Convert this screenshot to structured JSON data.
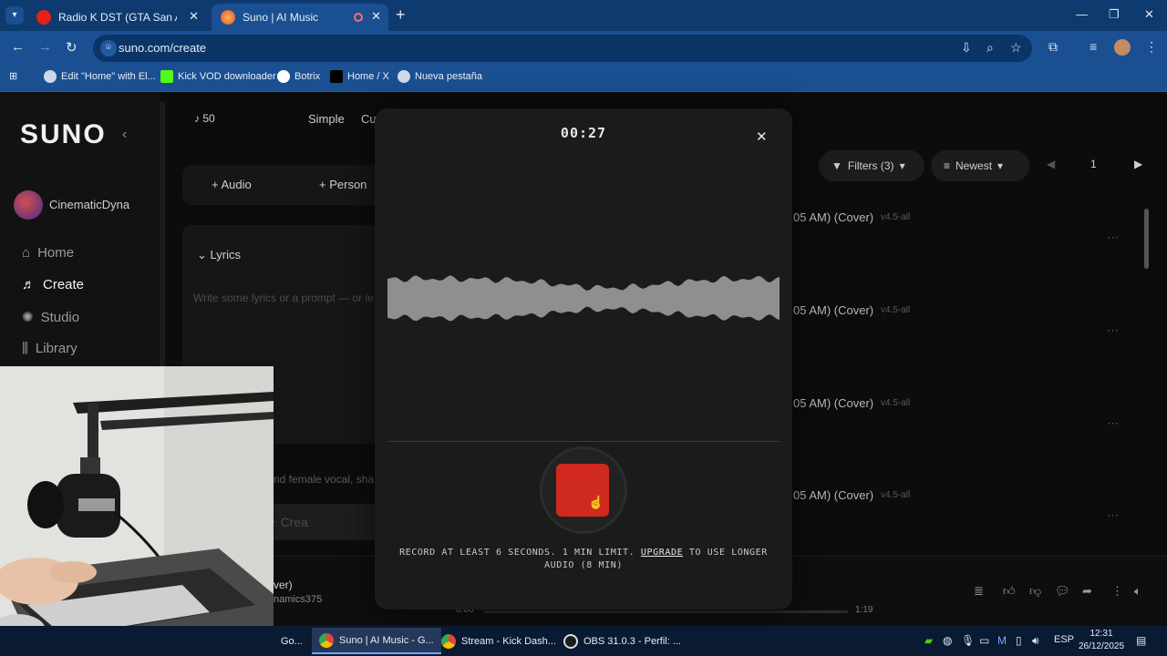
{
  "browser": {
    "tabs": [
      {
        "title": "Radio K DST (GTA San Andreas)",
        "active": false
      },
      {
        "title": "Suno | AI Music",
        "active": true
      }
    ],
    "url": "suno.com/create",
    "bookmarks": [
      "Edit \"Home\" with El...",
      "Kick VOD downloader",
      "Botrix",
      "Home / X",
      "Nueva pestaña"
    ]
  },
  "suno": {
    "logo": "SUNO",
    "user": "CinematicDyna",
    "nav": [
      "Home",
      "Create",
      "Studio",
      "Library"
    ],
    "credits": "50",
    "modes": [
      "Simple",
      "Cu"
    ],
    "add_audio": "Audio",
    "add_persona": "Person",
    "lyrics_label": "Lyrics",
    "lyrics_placeholder": "Write some lyrics or a prompt — or le",
    "styles_text": "nd female vocal, sha",
    "create_label": "Crea",
    "filters_label": "Filters (3)",
    "sort_label": "Newest",
    "page_number": "1",
    "songs": [
      {
        "title": "05 AM) (Cover)",
        "badge": "v4.5-all"
      },
      {
        "title": "05 AM) (Cover)",
        "badge": "v4.5-all"
      },
      {
        "title": "05 AM) (Cover)",
        "badge": "v4.5-all"
      },
      {
        "title": "05 AM) (Cover)",
        "badge": "v4.5-all"
      }
    ],
    "player": {
      "title": "ver)",
      "artist": "namics375",
      "elapsed": "0:00",
      "duration": "1:19"
    }
  },
  "recorder": {
    "timer": "00:27",
    "notice_before": "RECORD AT LEAST 6 SECONDS. 1 MIN LIMIT. ",
    "notice_link": "UPGRADE",
    "notice_after": " TO USE LONGER AUDIO (8 MIN)"
  },
  "taskbar": {
    "items": [
      "Go...",
      "Suno | AI Music - G...",
      "Stream - Kick Dash...",
      "OBS 31.0.3 - Perfil: ..."
    ],
    "lang": "ESP",
    "time": "12:31",
    "date": "26/12/2025"
  },
  "colors": {
    "tab_bar": "#0e3a70",
    "toolbar": "#1a4f92",
    "modal": "#1b1b1b",
    "record_stop": "#d02a1f",
    "page_bg": "#0c0c0c"
  }
}
